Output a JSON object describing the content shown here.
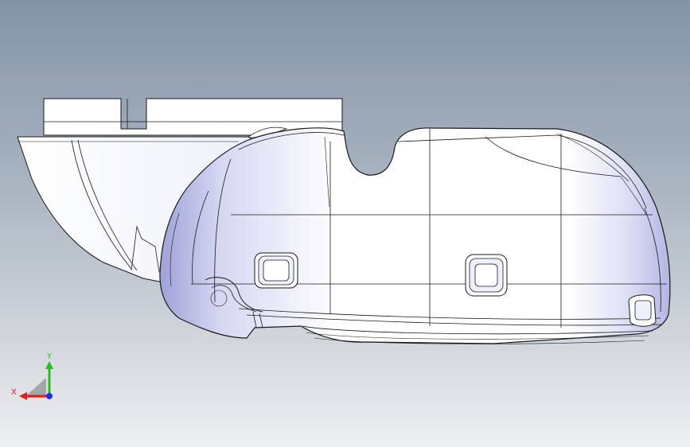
{
  "viewport": {
    "background_top": "#8494a5",
    "background_bottom": "#eeeff1"
  },
  "model": {
    "body_color": "#ffffff",
    "shade_color": "#b9bce6",
    "edge_color": "#1a1a1a"
  },
  "triad": {
    "x_label": "X",
    "y_label": "Y",
    "x_color": "#e02020",
    "y_color": "#20c020",
    "z_color": "#2030e0"
  }
}
